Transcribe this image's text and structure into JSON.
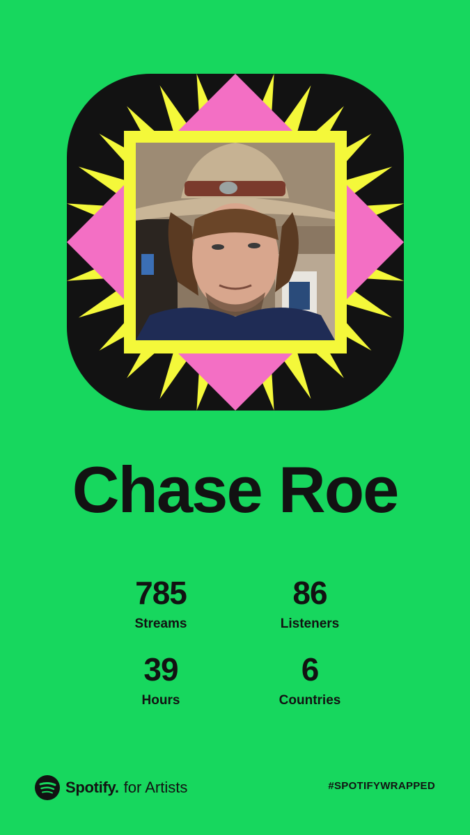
{
  "artist": {
    "name": "Chase Roe"
  },
  "stats": [
    {
      "value": "785",
      "label": "Streams"
    },
    {
      "value": "86",
      "label": "Listeners"
    },
    {
      "value": "39",
      "label": "Hours"
    },
    {
      "value": "6",
      "label": "Countries"
    }
  ],
  "footer": {
    "brand": "Spotify.",
    "brand_suffix": "for Artists",
    "hashtag": "#SPOTIFYWRAPPED"
  },
  "colors": {
    "background": "#17d75e",
    "black": "#121212",
    "yellow": "#f4f83a",
    "pink": "#f36fc4"
  },
  "icons": {
    "logo": "spotify-icon",
    "photo": "artist-portrait"
  }
}
